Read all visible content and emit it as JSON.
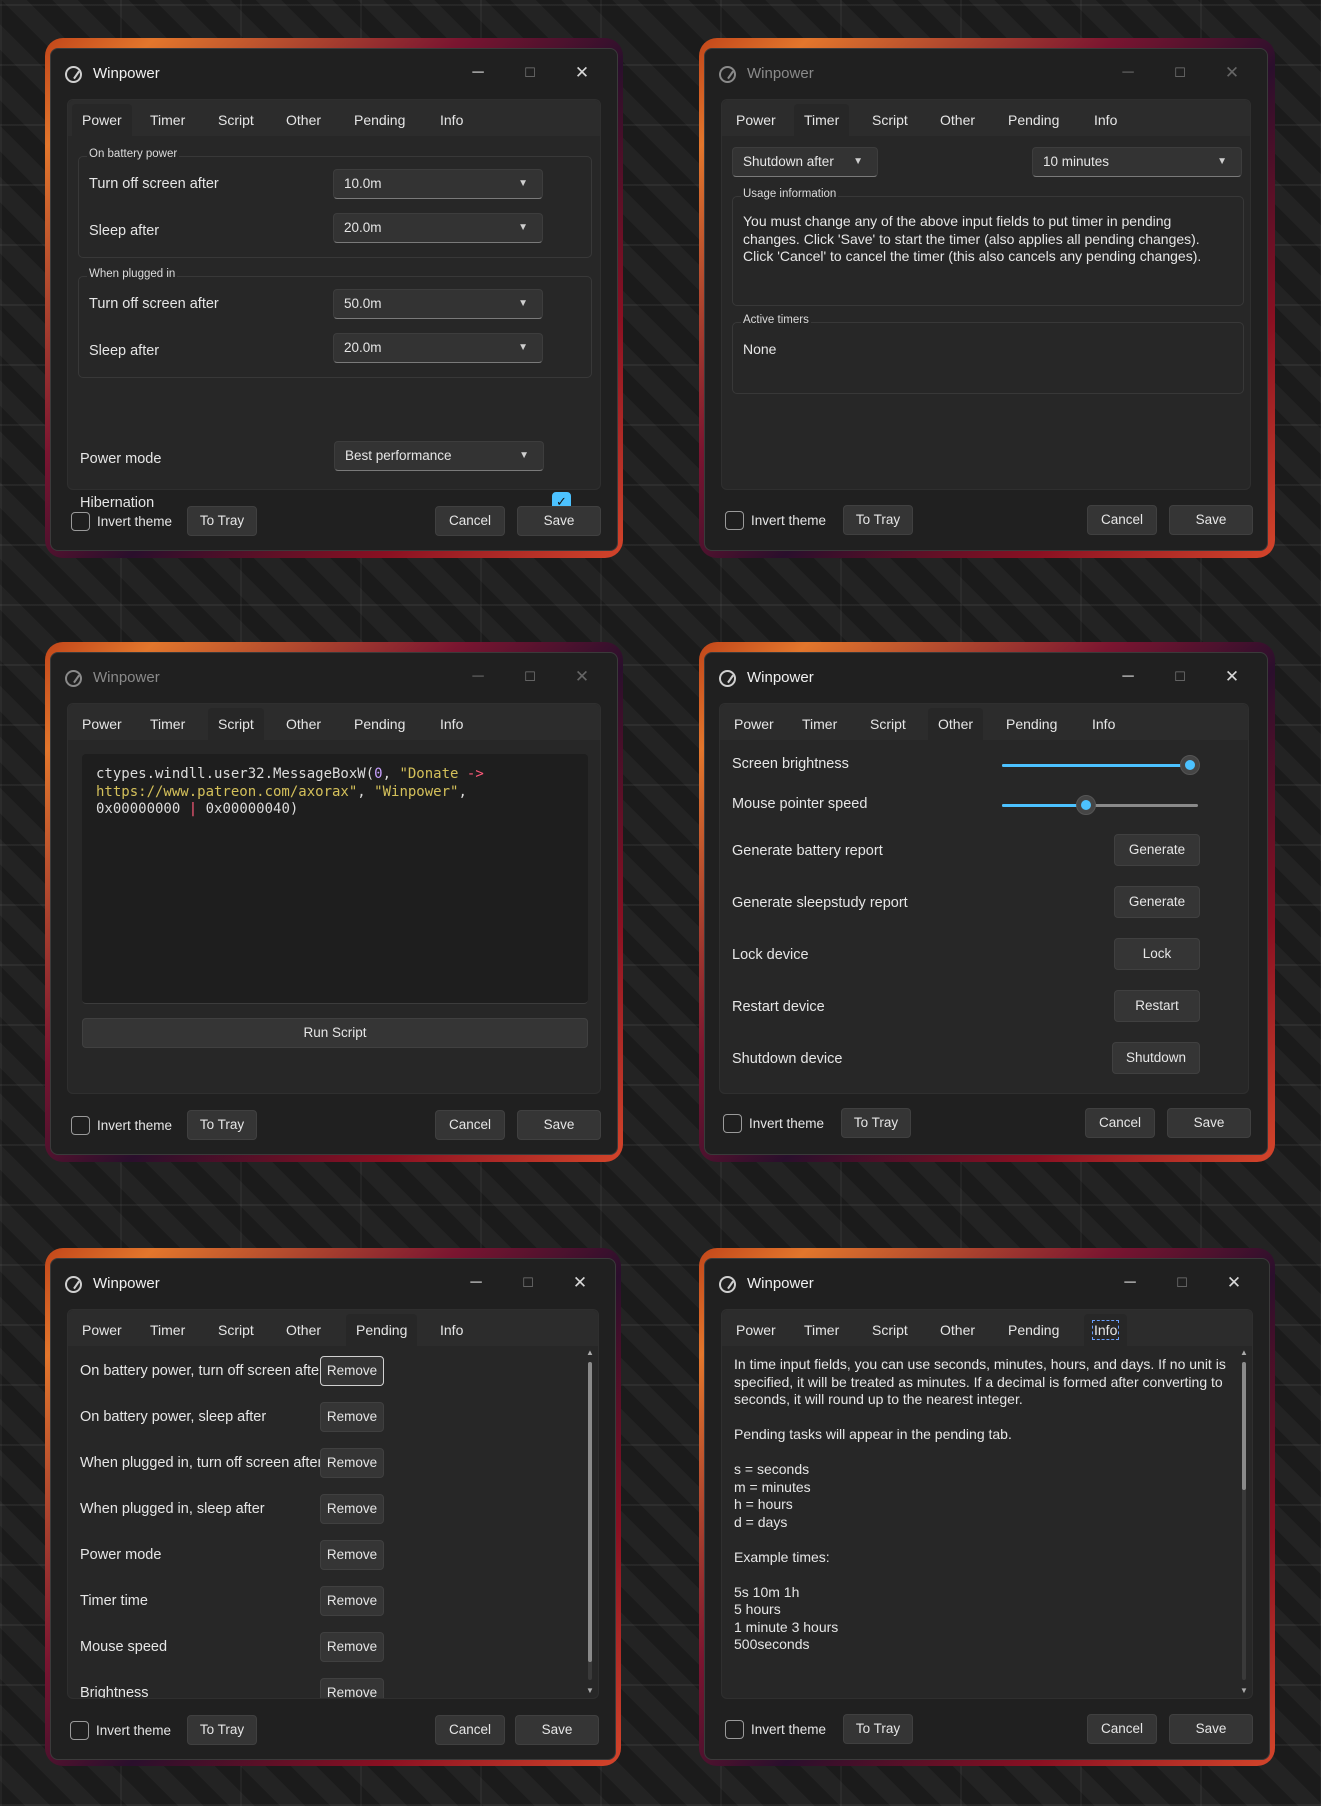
{
  "app": {
    "title": "Winpower",
    "tabs": [
      "Power",
      "Timer",
      "Script",
      "Other",
      "Pending",
      "Info"
    ],
    "footer": {
      "invert_theme": "Invert theme",
      "to_tray": "To Tray",
      "cancel": "Cancel",
      "save": "Save"
    },
    "window_controls": {
      "minimize": "─",
      "maximize": "☐",
      "close": "✕"
    }
  },
  "power": {
    "battery_group": "On battery power",
    "battery_screen_label": "Turn off screen after",
    "battery_screen_value": "10.0m",
    "battery_sleep_label": "Sleep after",
    "battery_sleep_value": "20.0m",
    "plugged_group": "When plugged in",
    "plugged_screen_label": "Turn off screen after",
    "plugged_screen_value": "50.0m",
    "plugged_sleep_label": "Sleep after",
    "plugged_sleep_value": "20.0m",
    "power_mode_label": "Power mode",
    "power_mode_value": "Best performance",
    "hibernation_label": "Hibernation",
    "hibernation_checked": true
  },
  "timer": {
    "action_value": "Shutdown after",
    "duration_value": "10 minutes",
    "usage_group": "Usage information",
    "usage_text": "You must change any of the above input fields to put timer in pending changes. Click 'Save' to start the timer (also applies all pending changes). Click 'Cancel' to cancel the timer (this also cancels any pending changes).",
    "active_group": "Active timers",
    "active_value": "None"
  },
  "script": {
    "code_parts": {
      "prefix": "ctypes.windll.user32.MessageBoxW(",
      "zero": "0",
      "comma1": ", ",
      "str1_line1": "\"Donate ",
      "arrow": "->",
      "str1_line2": "https://www.patreon.com/axorax\"",
      "comma2": ", ",
      "str2": "\"Winpower\"",
      "comma3": ",",
      "hex1": "0x00000000",
      "pipe": "|",
      "hex2": "0x00000040)"
    },
    "run_label": "Run Script"
  },
  "other": {
    "brightness_label": "Screen brightness",
    "brightness_value": 1.0,
    "mouse_label": "Mouse pointer speed",
    "mouse_value": 0.43,
    "battery_report_label": "Generate battery report",
    "battery_report_btn": "Generate",
    "sleepstudy_label": "Generate sleepstudy report",
    "sleepstudy_btn": "Generate",
    "lock_label": "Lock device",
    "lock_btn": "Lock",
    "restart_label": "Restart device",
    "restart_btn": "Restart",
    "shutdown_label": "Shutdown device",
    "shutdown_btn": "Shutdown"
  },
  "pending": {
    "remove_label": "Remove",
    "items": [
      "On battery power, turn off screen after",
      "On battery power, sleep after",
      "When plugged in, turn off screen after",
      "When plugged in, sleep after",
      "Power mode",
      "Timer time",
      "Mouse speed",
      "Brightness"
    ]
  },
  "info": {
    "para1": "In time input fields, you can use seconds, minutes, hours, and days. If no unit is specified, it will be treated as minutes. If a decimal is formed after converting to seconds, it will round up to the nearest integer.",
    "para2": "Pending tasks will appear in the pending tab.",
    "units": [
      "s = seconds",
      "m = minutes",
      "h = hours",
      "d = days"
    ],
    "examples_title": "Example times:",
    "examples": [
      "5s 10m 1h",
      "5 hours",
      "1 minute 3 hours",
      "500seconds"
    ]
  },
  "colors": {
    "accent": "#4cc2ff",
    "window_bg": "#202020",
    "content_bg": "#272727"
  }
}
